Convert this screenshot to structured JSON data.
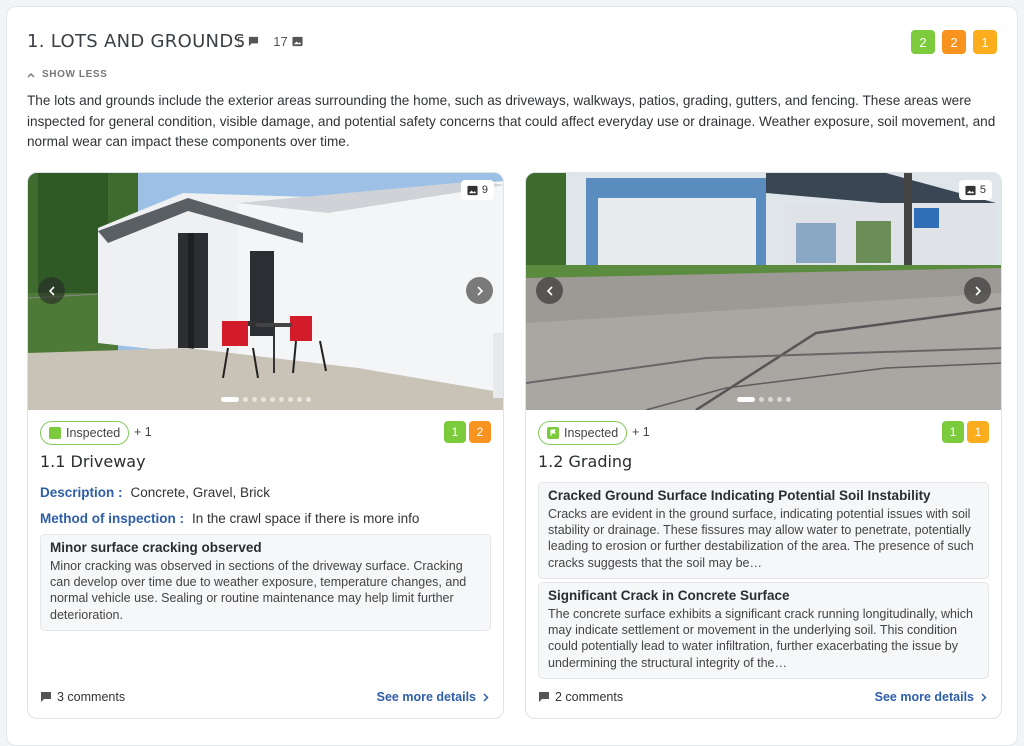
{
  "section": {
    "title": "1. LOTS AND GROUNDS",
    "comment_count": "5",
    "image_count": "17",
    "badges": [
      "2",
      "2",
      "1"
    ],
    "toggle_label": "SHOW LESS",
    "description": "The lots and grounds include the exterior areas surrounding the home, such as driveways, walkways, patios, grading, gutters, and fencing. These areas were inspected for general condition, visible damage, and potential safety concerns that could affect everyday use or drainage. Weather exposure, soil movement, and normal wear can impact these components over time."
  },
  "cards": [
    {
      "photo_count": "9",
      "status": "Inspected",
      "status_extra": "+ 1",
      "badges": [
        "1",
        "2"
      ],
      "title": "1.1 Driveway",
      "description_label": "Description :",
      "description_value": "Concrete, Gravel, Brick",
      "method_label": "Method of inspection :",
      "method_value": "In the crawl space if there is more info",
      "observations": [
        {
          "title": "Minor surface cracking observed",
          "text": "Minor cracking was observed in sections of the driveway surface. Cracking can develop over time due to weather exposure, temperature changes, and normal vehicle use. Sealing or routine maintenance may help limit further deterioration."
        }
      ],
      "comments": "3 comments",
      "more_label": "See more details"
    },
    {
      "photo_count": "5",
      "status": "Inspected",
      "status_extra": "+ 1",
      "badges": [
        "1",
        "1"
      ],
      "title": "1.2 Grading",
      "observations": [
        {
          "title": "Cracked Ground Surface Indicating Potential Soil Instability",
          "text": "Cracks are evident in the ground surface, indicating potential issues with soil stability or drainage. These fissures may allow water to penetrate, potentially leading to erosion or further destabilization of the area. The presence of such cracks suggests that the soil may be…"
        },
        {
          "title": "Significant Crack in Concrete Surface",
          "text": "The concrete surface exhibits a significant crack running longitudinally, which may indicate settlement or movement in the underlying soil. This condition could potentially lead to water infiltration, further exacerbating the issue by undermining the structural integrity of the…"
        }
      ],
      "comments": "2 comments",
      "more_label": "See more details"
    }
  ],
  "colors": {
    "green": "#7ccb3c",
    "orange": "#f7931e",
    "amber": "#fbad1e",
    "link": "#2f5ea8"
  }
}
